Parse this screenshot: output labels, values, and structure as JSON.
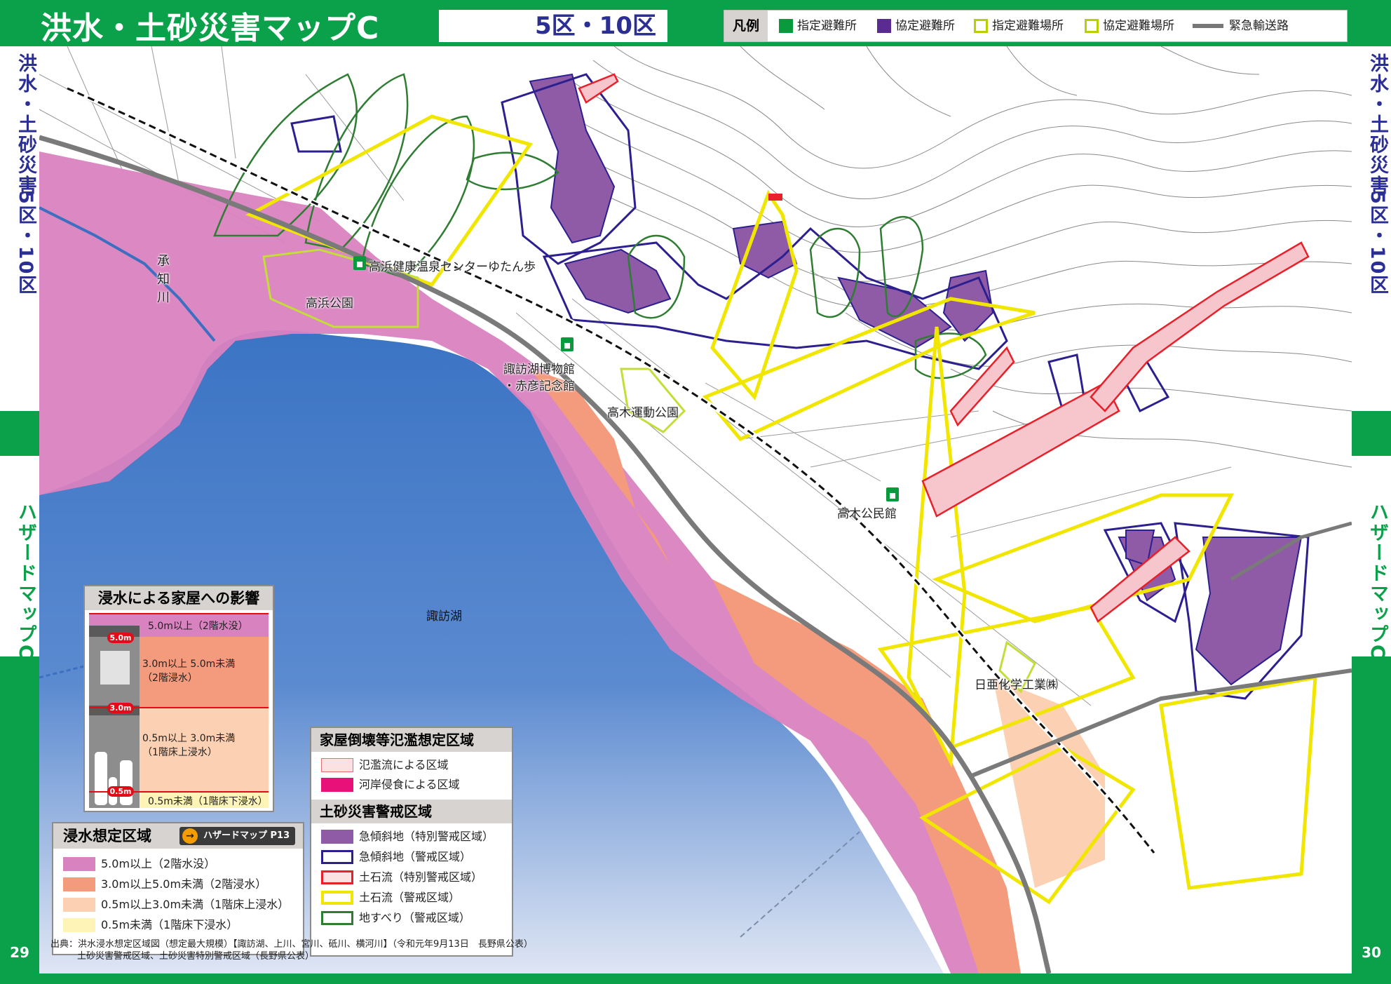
{
  "header": {
    "title": "洪水・土砂災害マップC",
    "district": "5区・10区",
    "legend_heading": "凡例",
    "legend_items": [
      {
        "label": "指定避難所",
        "icon": "designated-shelter-icon"
      },
      {
        "label": "協定避難所",
        "icon": "agreement-shelter-icon"
      },
      {
        "label": "指定避難場所",
        "icon": "designated-evacuation-site-icon"
      },
      {
        "label": "協定避難場所",
        "icon": "agreement-evacuation-site-icon"
      },
      {
        "label": "緊急輸送路",
        "icon": "emergency-route-icon"
      }
    ]
  },
  "side_left": {
    "top_text": "洪水・土砂災害",
    "mid_text": "5区・10区",
    "bottom_text": "ハザードマップC",
    "page_number": "29"
  },
  "side_right": {
    "top_text": "洪水・土砂災害",
    "mid_text": "5区・10区",
    "bottom_text": "ハザードマップC",
    "page_number": "30"
  },
  "map_labels": {
    "river": "承知川",
    "takahama_onsen": "高浜健康温泉センターゆたん歩",
    "takahama_park": "高浜公園",
    "museum_line1": "諏訪湖博物館",
    "museum_line2": "・赤彦記念館",
    "takagi_sports_park": "高木運動公園",
    "takagi_hall": "高木公民館",
    "lake": "諏訪湖",
    "nichia": "日亜化学工業㈱"
  },
  "flood_house_panel": {
    "title": "浸水による家屋への影響",
    "markers": [
      "5.0m",
      "3.0m",
      "0.5m"
    ],
    "rows": [
      {
        "label": "5.0m以上（2階水没）"
      },
      {
        "label": "3.0m以上 5.0m未満",
        "sub": "（2階浸水）"
      },
      {
        "label": "0.5m以上 3.0m未満",
        "sub": "（1階床上浸水）"
      },
      {
        "label": "0.5m未満（1階床下浸水）"
      }
    ]
  },
  "depth_legend": {
    "title": "浸水想定区域",
    "link_label": "ハザードマップ P13",
    "rows": [
      {
        "label": "5.0m以上（2階水没）",
        "color": "#d982c0"
      },
      {
        "label": "3.0m以上5.0m未満（2階浸水）",
        "color": "#f49b7d"
      },
      {
        "label": "0.5m以上3.0m未満（1階床上浸水）",
        "color": "#fcd0b2"
      },
      {
        "label": "0.5m未満（1階床下浸水）",
        "color": "#fef4b7"
      }
    ]
  },
  "hazard_legend": {
    "collapse_title": "家屋倒壊等氾濫想定区域",
    "collapse_rows": [
      {
        "label": "氾濫流による区域"
      },
      {
        "label": "河岸侵食による区域"
      }
    ],
    "sediment_title": "土砂災害警戒区域",
    "sediment_rows": [
      {
        "label": "急傾斜地（特別警戒区域）"
      },
      {
        "label": "急傾斜地（警戒区域）"
      },
      {
        "label": "土石流（特別警戒区域）"
      },
      {
        "label": "土石流（警戒区域）"
      },
      {
        "label": "地すべり（警戒区域）"
      }
    ]
  },
  "colors": {
    "frame_green": "#0aa14a",
    "title_navy": "#2b2f93",
    "lake_blue": "#3f79c6",
    "flood_5m": "#d982c0",
    "flood_3m": "#f49b7d",
    "flood_05m": "#fcd0b2",
    "steep_special": "#8f5aa6",
    "steep_warning": "#2c1f8f",
    "debris_special": "#e8202a",
    "debris_warning": "#f1e600",
    "landslide": "#2e7d32"
  },
  "source": {
    "line1": "出典：洪水浸水想定区域図（想定最大規模）【諏訪湖、上川、宮川、砥川、横河川】（令和元年9月13日　長野県公表）",
    "line2": "土砂災害警戒区域、土砂災害特別警戒区域（長野県公表）"
  }
}
